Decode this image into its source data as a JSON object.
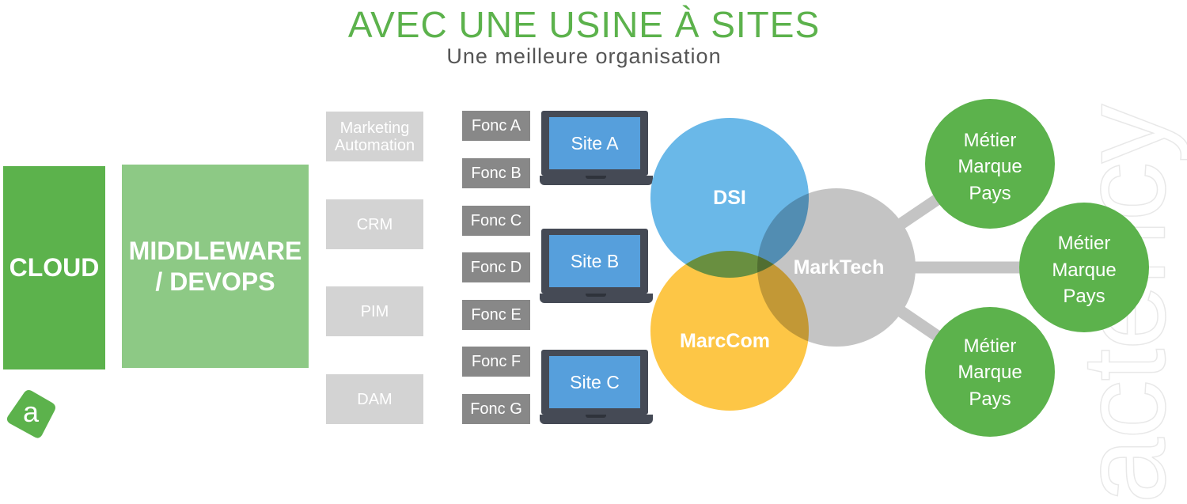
{
  "header": {
    "title": "AVEC UNE USINE À SITES",
    "subtitle": "Une meilleure organisation"
  },
  "layers": {
    "cloud": "CLOUD",
    "middleware_line1": "MIDDLEWARE",
    "middleware_line2": "/ DEVOPS"
  },
  "tools": [
    {
      "line1": "Marketing",
      "line2": "Automation"
    },
    {
      "line1": "CRM",
      "line2": ""
    },
    {
      "line1": "PIM",
      "line2": ""
    },
    {
      "line1": "DAM",
      "line2": ""
    }
  ],
  "functions": [
    "Fonc A",
    "Fonc B",
    "Fonc C",
    "Fonc D",
    "Fonc E",
    "Fonc F",
    "Fonc G"
  ],
  "sites": [
    "Site A",
    "Site B",
    "Site C"
  ],
  "venn": {
    "dsi": "DSI",
    "marccom": "MarcCom",
    "marktech": "MarkTech"
  },
  "metiers": [
    {
      "line1": "Métier",
      "line2": "Marque",
      "line3": "Pays"
    },
    {
      "line1": "Métier",
      "line2": "Marque",
      "line3": "Pays"
    },
    {
      "line1": "Métier",
      "line2": "Marque",
      "line3": "Pays"
    }
  ],
  "logo": {
    "letter": "a",
    "watermark": "actency"
  },
  "colors": {
    "green": "#5cb24c",
    "light_green": "#8dc985",
    "blue": "#6ab8e8",
    "yellow": "#fdc646",
    "gray": "#c4c4c4",
    "fonc_gray": "#888888",
    "tool_gray": "#d3d3d3"
  }
}
